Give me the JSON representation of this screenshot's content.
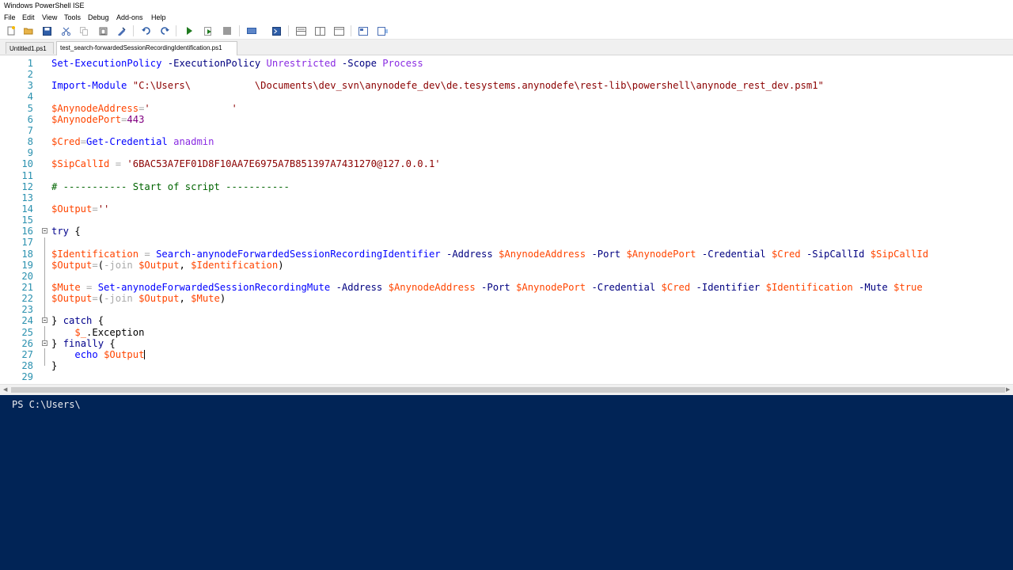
{
  "window": {
    "title": "Windows PowerShell ISE"
  },
  "menu": [
    "File",
    "Edit",
    "View",
    "Tools",
    "Debug",
    "Add-ons",
    "Help"
  ],
  "toolbar": {
    "icons": [
      "new-file-icon",
      "open-file-icon",
      "save-icon",
      "cut-icon",
      "copy-icon",
      "paste-icon",
      "clear-icon",
      "undo-icon",
      "redo-icon",
      "run-script-icon",
      "run-selection-icon",
      "stop-icon",
      "new-remote-tab-icon",
      "start-powershell-icon",
      "layout-script-top-icon",
      "layout-script-right-icon",
      "layout-script-maximized-icon",
      "show-script-pane-icon",
      "show-command-addon-icon"
    ]
  },
  "tabs": [
    {
      "label": "Untitled1.ps1",
      "active": false
    },
    {
      "label": "test_search-forwardedSessionRecordingIdentification.ps1",
      "active": true
    }
  ],
  "editor": {
    "lines": [
      {
        "n": "1",
        "tokens": [
          [
            "cmd",
            "Set-ExecutionPolicy"
          ],
          [
            "pl",
            " "
          ],
          [
            "par",
            "-ExecutionPolicy"
          ],
          [
            "pl",
            " "
          ],
          [
            "arg",
            "Unrestricted"
          ],
          [
            "pl",
            " "
          ],
          [
            "par",
            "-Scope"
          ],
          [
            "pl",
            " "
          ],
          [
            "arg",
            "Process"
          ]
        ]
      },
      {
        "n": "2",
        "tokens": []
      },
      {
        "n": "3",
        "tokens": [
          [
            "cmd",
            "Import-Module"
          ],
          [
            "pl",
            " "
          ],
          [
            "str",
            "\"C:\\Users\\           \\Documents\\dev_svn\\anynodefe_dev\\de.tesystems.anynodefe\\rest-lib\\powershell\\anynode_rest_dev.psm1\""
          ]
        ]
      },
      {
        "n": "4",
        "tokens": []
      },
      {
        "n": "5",
        "tokens": [
          [
            "var",
            "$AnynodeAddress"
          ],
          [
            "op",
            "="
          ],
          [
            "str",
            "'              '"
          ]
        ]
      },
      {
        "n": "6",
        "tokens": [
          [
            "var",
            "$AnynodePort"
          ],
          [
            "op",
            "="
          ],
          [
            "num",
            "443"
          ]
        ]
      },
      {
        "n": "7",
        "tokens": []
      },
      {
        "n": "8",
        "tokens": [
          [
            "var",
            "$Cred"
          ],
          [
            "op",
            "="
          ],
          [
            "cmd",
            "Get-Credential"
          ],
          [
            "pl",
            " "
          ],
          [
            "arg",
            "anadmin"
          ]
        ]
      },
      {
        "n": "9",
        "tokens": []
      },
      {
        "n": "10",
        "tokens": [
          [
            "var",
            "$SipCallId"
          ],
          [
            "pl",
            " "
          ],
          [
            "op",
            "="
          ],
          [
            "pl",
            " "
          ],
          [
            "str",
            "'6BAC53A7EF01D8F10AA7E6975A7B851397A7431270@127.0.0.1'"
          ]
        ]
      },
      {
        "n": "11",
        "tokens": []
      },
      {
        "n": "12",
        "tokens": [
          [
            "com",
            "# ----------- Start of script -----------"
          ]
        ]
      },
      {
        "n": "13",
        "tokens": []
      },
      {
        "n": "14",
        "tokens": [
          [
            "var",
            "$Output"
          ],
          [
            "op",
            "="
          ],
          [
            "str",
            "''"
          ]
        ]
      },
      {
        "n": "15",
        "tokens": []
      },
      {
        "n": "16",
        "tokens": [
          [
            "kw",
            "try"
          ],
          [
            "pl",
            " {"
          ]
        ]
      },
      {
        "n": "17",
        "tokens": []
      },
      {
        "n": "18",
        "tokens": [
          [
            "var",
            "$Identification"
          ],
          [
            "pl",
            " "
          ],
          [
            "op",
            "="
          ],
          [
            "pl",
            " "
          ],
          [
            "cmd",
            "Search-anynodeForwardedSessionRecordingIdentifier"
          ],
          [
            "pl",
            " "
          ],
          [
            "par",
            "-Address"
          ],
          [
            "pl",
            " "
          ],
          [
            "var",
            "$AnynodeAddress"
          ],
          [
            "pl",
            " "
          ],
          [
            "par",
            "-Port"
          ],
          [
            "pl",
            " "
          ],
          [
            "var",
            "$AnynodePort"
          ],
          [
            "pl",
            " "
          ],
          [
            "par",
            "-Credential"
          ],
          [
            "pl",
            " "
          ],
          [
            "var",
            "$Cred"
          ],
          [
            "pl",
            " "
          ],
          [
            "par",
            "-SipCallId"
          ],
          [
            "pl",
            " "
          ],
          [
            "var",
            "$SipCallId"
          ]
        ]
      },
      {
        "n": "19",
        "tokens": [
          [
            "var",
            "$Output"
          ],
          [
            "op",
            "="
          ],
          [
            "pl",
            "("
          ],
          [
            "op",
            "-join"
          ],
          [
            "pl",
            " "
          ],
          [
            "var",
            "$Output"
          ],
          [
            "pl",
            ", "
          ],
          [
            "var",
            "$Identification"
          ],
          [
            "pl",
            ")"
          ]
        ]
      },
      {
        "n": "20",
        "tokens": []
      },
      {
        "n": "21",
        "tokens": [
          [
            "var",
            "$Mute"
          ],
          [
            "pl",
            " "
          ],
          [
            "op",
            "="
          ],
          [
            "pl",
            " "
          ],
          [
            "cmd",
            "Set-anynodeForwardedSessionRecordingMute"
          ],
          [
            "pl",
            " "
          ],
          [
            "par",
            "-Address"
          ],
          [
            "pl",
            " "
          ],
          [
            "var",
            "$AnynodeAddress"
          ],
          [
            "pl",
            " "
          ],
          [
            "par",
            "-Port"
          ],
          [
            "pl",
            " "
          ],
          [
            "var",
            "$AnynodePort"
          ],
          [
            "pl",
            " "
          ],
          [
            "par",
            "-Credential"
          ],
          [
            "pl",
            " "
          ],
          [
            "var",
            "$Cred"
          ],
          [
            "pl",
            " "
          ],
          [
            "par",
            "-Identifier"
          ],
          [
            "pl",
            " "
          ],
          [
            "var",
            "$Identification"
          ],
          [
            "pl",
            " "
          ],
          [
            "par",
            "-Mute"
          ],
          [
            "pl",
            " "
          ],
          [
            "var",
            "$true"
          ]
        ]
      },
      {
        "n": "22",
        "tokens": [
          [
            "var",
            "$Output"
          ],
          [
            "op",
            "="
          ],
          [
            "pl",
            "("
          ],
          [
            "op",
            "-join"
          ],
          [
            "pl",
            " "
          ],
          [
            "var",
            "$Output"
          ],
          [
            "pl",
            ", "
          ],
          [
            "var",
            "$Mute"
          ],
          [
            "pl",
            ")"
          ]
        ]
      },
      {
        "n": "23",
        "tokens": []
      },
      {
        "n": "24",
        "tokens": [
          [
            "pl",
            "} "
          ],
          [
            "kw",
            "catch"
          ],
          [
            "pl",
            " {"
          ]
        ]
      },
      {
        "n": "25",
        "tokens": [
          [
            "pl",
            "    "
          ],
          [
            "var",
            "$_"
          ],
          [
            "pl",
            ".Exception"
          ]
        ]
      },
      {
        "n": "26",
        "tokens": [
          [
            "pl",
            "} "
          ],
          [
            "kw",
            "finally"
          ],
          [
            "pl",
            " {"
          ]
        ]
      },
      {
        "n": "27",
        "tokens": [
          [
            "pl",
            "    "
          ],
          [
            "cmd",
            "echo"
          ],
          [
            "pl",
            " "
          ],
          [
            "var",
            "$Output"
          ]
        ]
      },
      {
        "n": "28",
        "tokens": [
          [
            "pl",
            "}"
          ]
        ]
      },
      {
        "n": "29",
        "tokens": []
      }
    ]
  },
  "console": {
    "prompt": "PS C:\\Users\\"
  },
  "colors": {
    "console_bg": "#012456",
    "line_number": "#2b91af"
  }
}
